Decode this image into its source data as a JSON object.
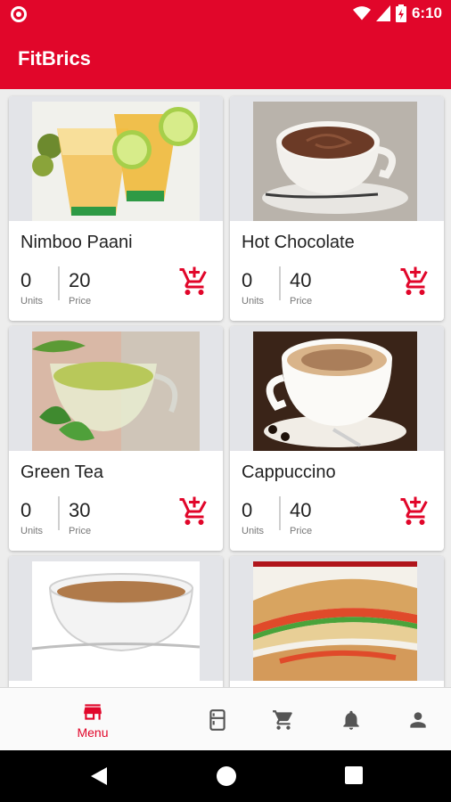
{
  "status_bar": {
    "time": "6:10"
  },
  "app": {
    "title": "FitBrics"
  },
  "labels": {
    "units": "Units",
    "price": "Price"
  },
  "colors": {
    "primary": "#e1062a",
    "icon_grey": "#555555"
  },
  "products": [
    {
      "name": "Nimboo Paani",
      "units": "0",
      "price": "20",
      "image": "lemonade-image"
    },
    {
      "name": "Hot Chocolate",
      "units": "0",
      "price": "40",
      "image": "hot-chocolate-image"
    },
    {
      "name": "Green Tea",
      "units": "0",
      "price": "30",
      "image": "green-tea-image"
    },
    {
      "name": "Cappuccino",
      "units": "0",
      "price": "40",
      "image": "cappuccino-image"
    },
    {
      "name": "",
      "units": "",
      "price": "",
      "image": "milk-tea-image"
    },
    {
      "name": "",
      "units": "",
      "price": "",
      "image": "sandwich-image"
    }
  ],
  "bottom_nav": {
    "items": [
      {
        "label": "Menu",
        "icon": "store-icon",
        "active": true
      },
      {
        "label": "",
        "icon": "fridge-icon",
        "active": false
      },
      {
        "label": "",
        "icon": "cart-icon",
        "active": false
      },
      {
        "label": "",
        "icon": "bell-icon",
        "active": false
      },
      {
        "label": "",
        "icon": "person-icon",
        "active": false
      }
    ]
  }
}
